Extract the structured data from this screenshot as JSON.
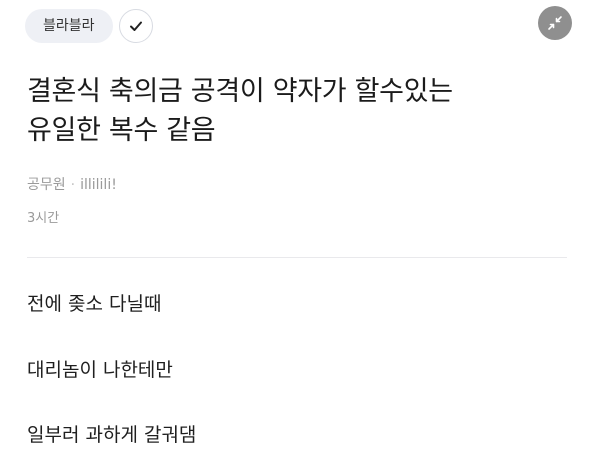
{
  "header": {
    "category": "블라블라",
    "check_icon": "checkmark-icon",
    "expand_icon": "collapse-arrows-icon"
  },
  "post": {
    "title_lines": [
      "결혼식 축의금 공격이 약자가 할수있는",
      "유일한 복수 같음"
    ],
    "author_company": "공무원",
    "author_name": "illilili!",
    "time": "3시간",
    "body_lines": [
      "전에 좆소 다닐때",
      "대리놈이 나한테만",
      "일부러 과하게 갈궈댐"
    ]
  },
  "colors": {
    "chip_bg": "#eef0f5",
    "expand_bg": "#8f8f8f",
    "meta_text": "#9a9a9a"
  }
}
